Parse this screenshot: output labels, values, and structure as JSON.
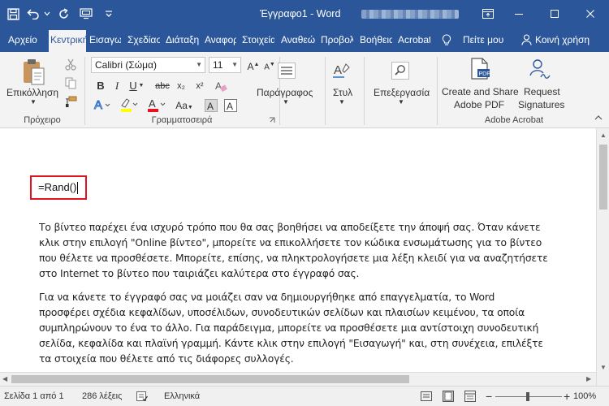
{
  "window": {
    "title": "Έγγραφο1 - Word",
    "accent": "#2b579a"
  },
  "tabs": [
    {
      "label": "Αρχείο",
      "active": false
    },
    {
      "label": "Κεντρική",
      "active": true
    },
    {
      "label": "Εισαγωγή",
      "active": false
    },
    {
      "label": "Σχεδίαση",
      "active": false
    },
    {
      "label": "Διάταξη",
      "active": false
    },
    {
      "label": "Αναφορές",
      "active": false
    },
    {
      "label": "Στοιχεία",
      "active": false
    },
    {
      "label": "Αναθεώρηση",
      "active": false
    },
    {
      "label": "Προβολή",
      "active": false
    },
    {
      "label": "Βοήθεια",
      "active": false
    },
    {
      "label": "Acrobat",
      "active": false
    }
  ],
  "tell_me": "Πείτε μου",
  "share": "Κοινή χρήση",
  "ribbon": {
    "clipboard": {
      "paste_label": "Επικόλληση",
      "group_label": "Πρόχειρο"
    },
    "font": {
      "font_name": "Calibri (Σώμα)",
      "font_size": "11",
      "group_label": "Γραμματοσειρά",
      "bold": "B",
      "italic": "I",
      "underline": "U",
      "strike": "abc",
      "subscript": "x₂",
      "superscript": "x²"
    },
    "paragraph": {
      "label": "Παράγραφος"
    },
    "styles": {
      "label": "Στυλ"
    },
    "editing": {
      "label": "Επεξεργασία"
    },
    "acrobat": {
      "create_share_line1": "Create and Share",
      "create_share_line2": "Adobe PDF",
      "request_line1": "Request",
      "request_line2": "Signatures",
      "group_label": "Adobe Acrobat"
    }
  },
  "document": {
    "formula": "=Rand()",
    "paragraph1": [
      "Το βίντεο παρέχει ένα ισχυρό τρόπο που θα σας βοηθήσει να αποδείξετε την άποψή σας. Όταν κάνετε",
      "κλικ στην επιλογή \"Online βίντεο\", μπορείτε να επικολλήσετε τον κώδικα ενσωμάτωσης για το βίντεο",
      "που θέλετε να προσθέσετε. Μπορείτε, επίσης, να πληκτρολογήσετε μια λέξη κλειδί για να αναζητήσετε",
      "στο Internet το βίντεο που ταιριάζει καλύτερα στο έγγραφό σας."
    ],
    "paragraph2": [
      "Για να κάνετε το έγγραφό σας να μοιάζει σαν να δημιουργήθηκε από επαγγελματία, το Word",
      "προσφέρει σχέδια κεφαλίδων, υποσέλιδων, συνοδευτικών σελίδων και πλαισίων κειμένου, τα οποία",
      "συμπληρώνουν το ένα το άλλο. Για παράδειγμα, μπορείτε να προσθέσετε μια αντίστοιχη συνοδευτική",
      "σελίδα, κεφαλίδα και πλαϊνή γραμμή. Κάντε κλικ στην επιλογή \"Εισαγωγή\" και, στη συνέχεια, επιλέξτε",
      "τα στοιχεία που θέλετε από τις διάφορες συλλογές."
    ]
  },
  "status": {
    "page": "Σελίδα 1 από 1",
    "words": "286 λέξεις",
    "language": "Ελληνικά",
    "zoom_minus": "−",
    "zoom_plus": "+",
    "zoom": "100%"
  }
}
